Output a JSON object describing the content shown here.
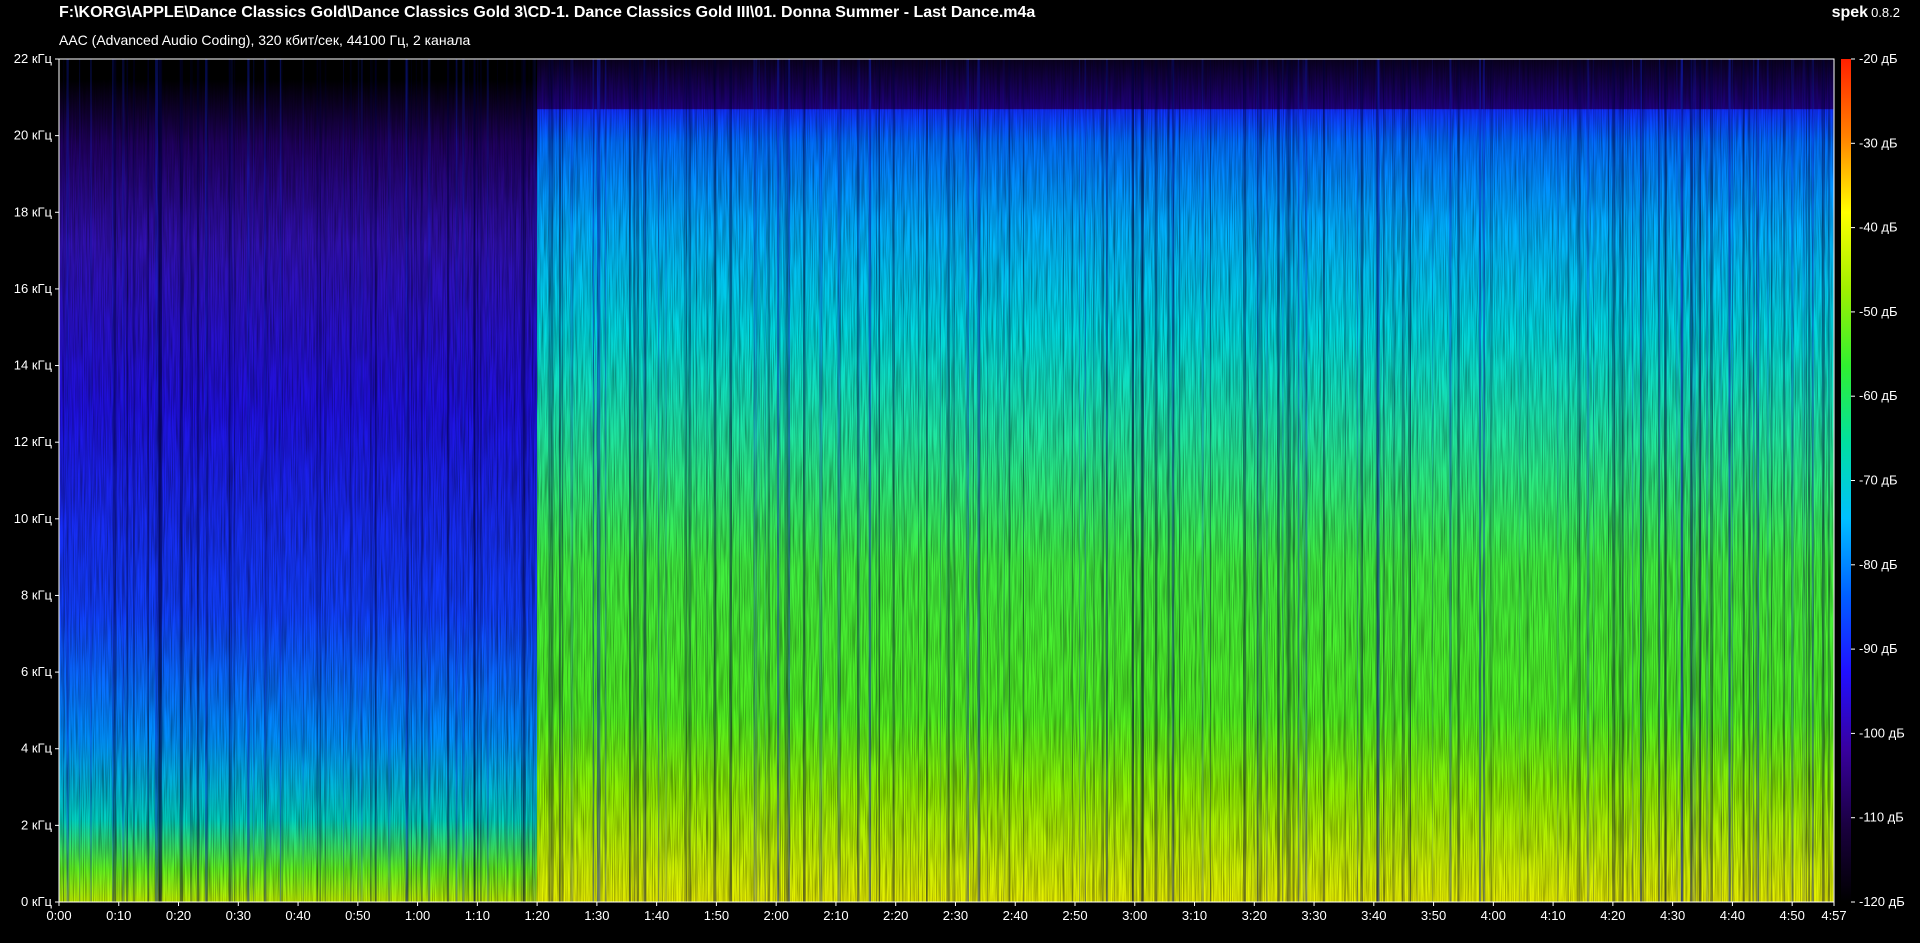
{
  "header": {
    "file_path": "F:\\KORG\\APPLE\\Dance Classics Gold\\Dance Classics Gold 3\\CD-1. Dance Classics Gold III\\01. Donna Summer - Last Dance.m4a",
    "info": "AAC (Advanced Audio Coding), 320 кбит/сек, 44100 Гц, 2 канала"
  },
  "brand": {
    "name": "spek",
    "version": "0.8.2"
  },
  "chart_data": {
    "type": "heatmap",
    "description_kind": "spectrogram",
    "x_ticks": [
      "0:00",
      "0:10",
      "0:20",
      "0:30",
      "0:40",
      "0:50",
      "1:00",
      "1:10",
      "1:20",
      "1:30",
      "1:40",
      "1:50",
      "2:00",
      "2:10",
      "2:20",
      "2:30",
      "2:40",
      "2:50",
      "3:00",
      "3:10",
      "3:20",
      "3:30",
      "3:40",
      "3:50",
      "4:00",
      "4:10",
      "4:20",
      "4:30",
      "4:40",
      "4:50",
      "4:57"
    ],
    "x_tick_seconds": [
      0,
      10,
      20,
      30,
      40,
      50,
      60,
      70,
      80,
      90,
      100,
      110,
      120,
      130,
      140,
      150,
      160,
      170,
      180,
      190,
      200,
      210,
      220,
      230,
      240,
      250,
      260,
      270,
      280,
      290,
      297
    ],
    "xlim_seconds": [
      0,
      297
    ],
    "y_ticks": [
      "0 кГц",
      "2 кГц",
      "4 кГц",
      "6 кГц",
      "8 кГц",
      "10 кГц",
      "12 кГц",
      "14 кГц",
      "16 кГц",
      "18 кГц",
      "20 кГц",
      "22 кГц"
    ],
    "y_tick_khz": [
      0,
      2,
      4,
      6,
      8,
      10,
      12,
      14,
      16,
      18,
      20,
      22
    ],
    "ylim_khz": [
      0,
      22
    ],
    "colorbar_ticks": [
      "-20 дБ",
      "-30 дБ",
      "-40 дБ",
      "-50 дБ",
      "-60 дБ",
      "-70 дБ",
      "-80 дБ",
      "-90 дБ",
      "-100 дБ",
      "-110 дБ",
      "-120 дБ"
    ],
    "colorbar_db": [
      -20,
      -30,
      -40,
      -50,
      -60,
      -70,
      -80,
      -90,
      -100,
      -110,
      -120
    ],
    "colorbar_range_db": [
      -120,
      -20
    ],
    "colormap": [
      "#000000",
      "#1a0040",
      "#3800a0",
      "#2010ff",
      "#0060ff",
      "#00c0ff",
      "#00e0a0",
      "#30f030",
      "#a0f000",
      "#ffff00",
      "#ff8000",
      "#ff2000"
    ],
    "lowpass_cutoff_khz": 20.7,
    "intro_end_seconds": 80
  }
}
